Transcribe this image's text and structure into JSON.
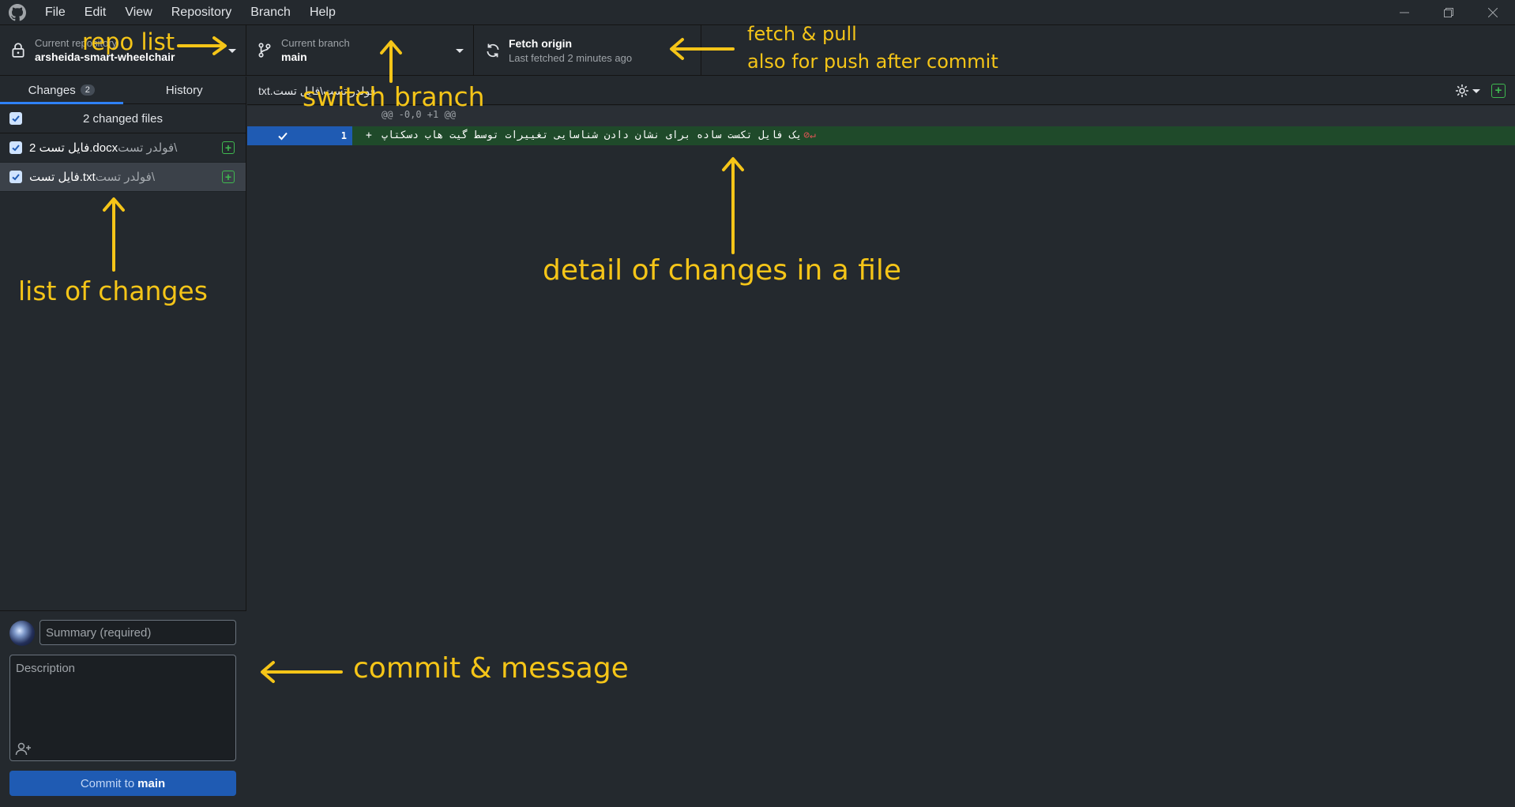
{
  "menu": [
    "File",
    "Edit",
    "View",
    "Repository",
    "Branch",
    "Help"
  ],
  "toolbar": {
    "repo_label": "Current repository",
    "repo_name": "arsheida-smart-wheelchair",
    "branch_label": "Current branch",
    "branch_name": "main",
    "fetch_title": "Fetch origin",
    "fetch_sub": "Last fetched 2 minutes ago"
  },
  "sidebar": {
    "tab_changes": "Changes",
    "tab_changes_count": "2",
    "tab_history": "History",
    "files_header": "2 changed files",
    "files": [
      {
        "dir": "فولدر تست\\",
        "name": "فایل تست 2.docx"
      },
      {
        "dir": "فولدر تست\\",
        "name": "فایل تست.txt"
      }
    ]
  },
  "commit": {
    "summary_placeholder": "Summary (required)",
    "description_placeholder": "Description",
    "button_prefix": "Commit to",
    "button_branch": "main"
  },
  "diff": {
    "path": "فولدر تست\\فایل تست.txt",
    "hunk_header": "@@ -0,0 +1 @@",
    "line_number": "1",
    "line_sign": "+",
    "line_text": "یک فایل تکست ساده برای نشان دادن شناسایی تغییرات توسط گیت هاب دسکتاپ",
    "no_newline_marker": "⊘↵"
  },
  "annotations": {
    "repo_list": "repo list",
    "switch_branch": "switch branch",
    "fetch_line1": "fetch & pull",
    "fetch_line2": "also for push after commit",
    "list_changes": "list of changes",
    "detail_changes": "detail of changes in a file",
    "commit_message": "commit & message",
    "color": "#f5c518"
  }
}
